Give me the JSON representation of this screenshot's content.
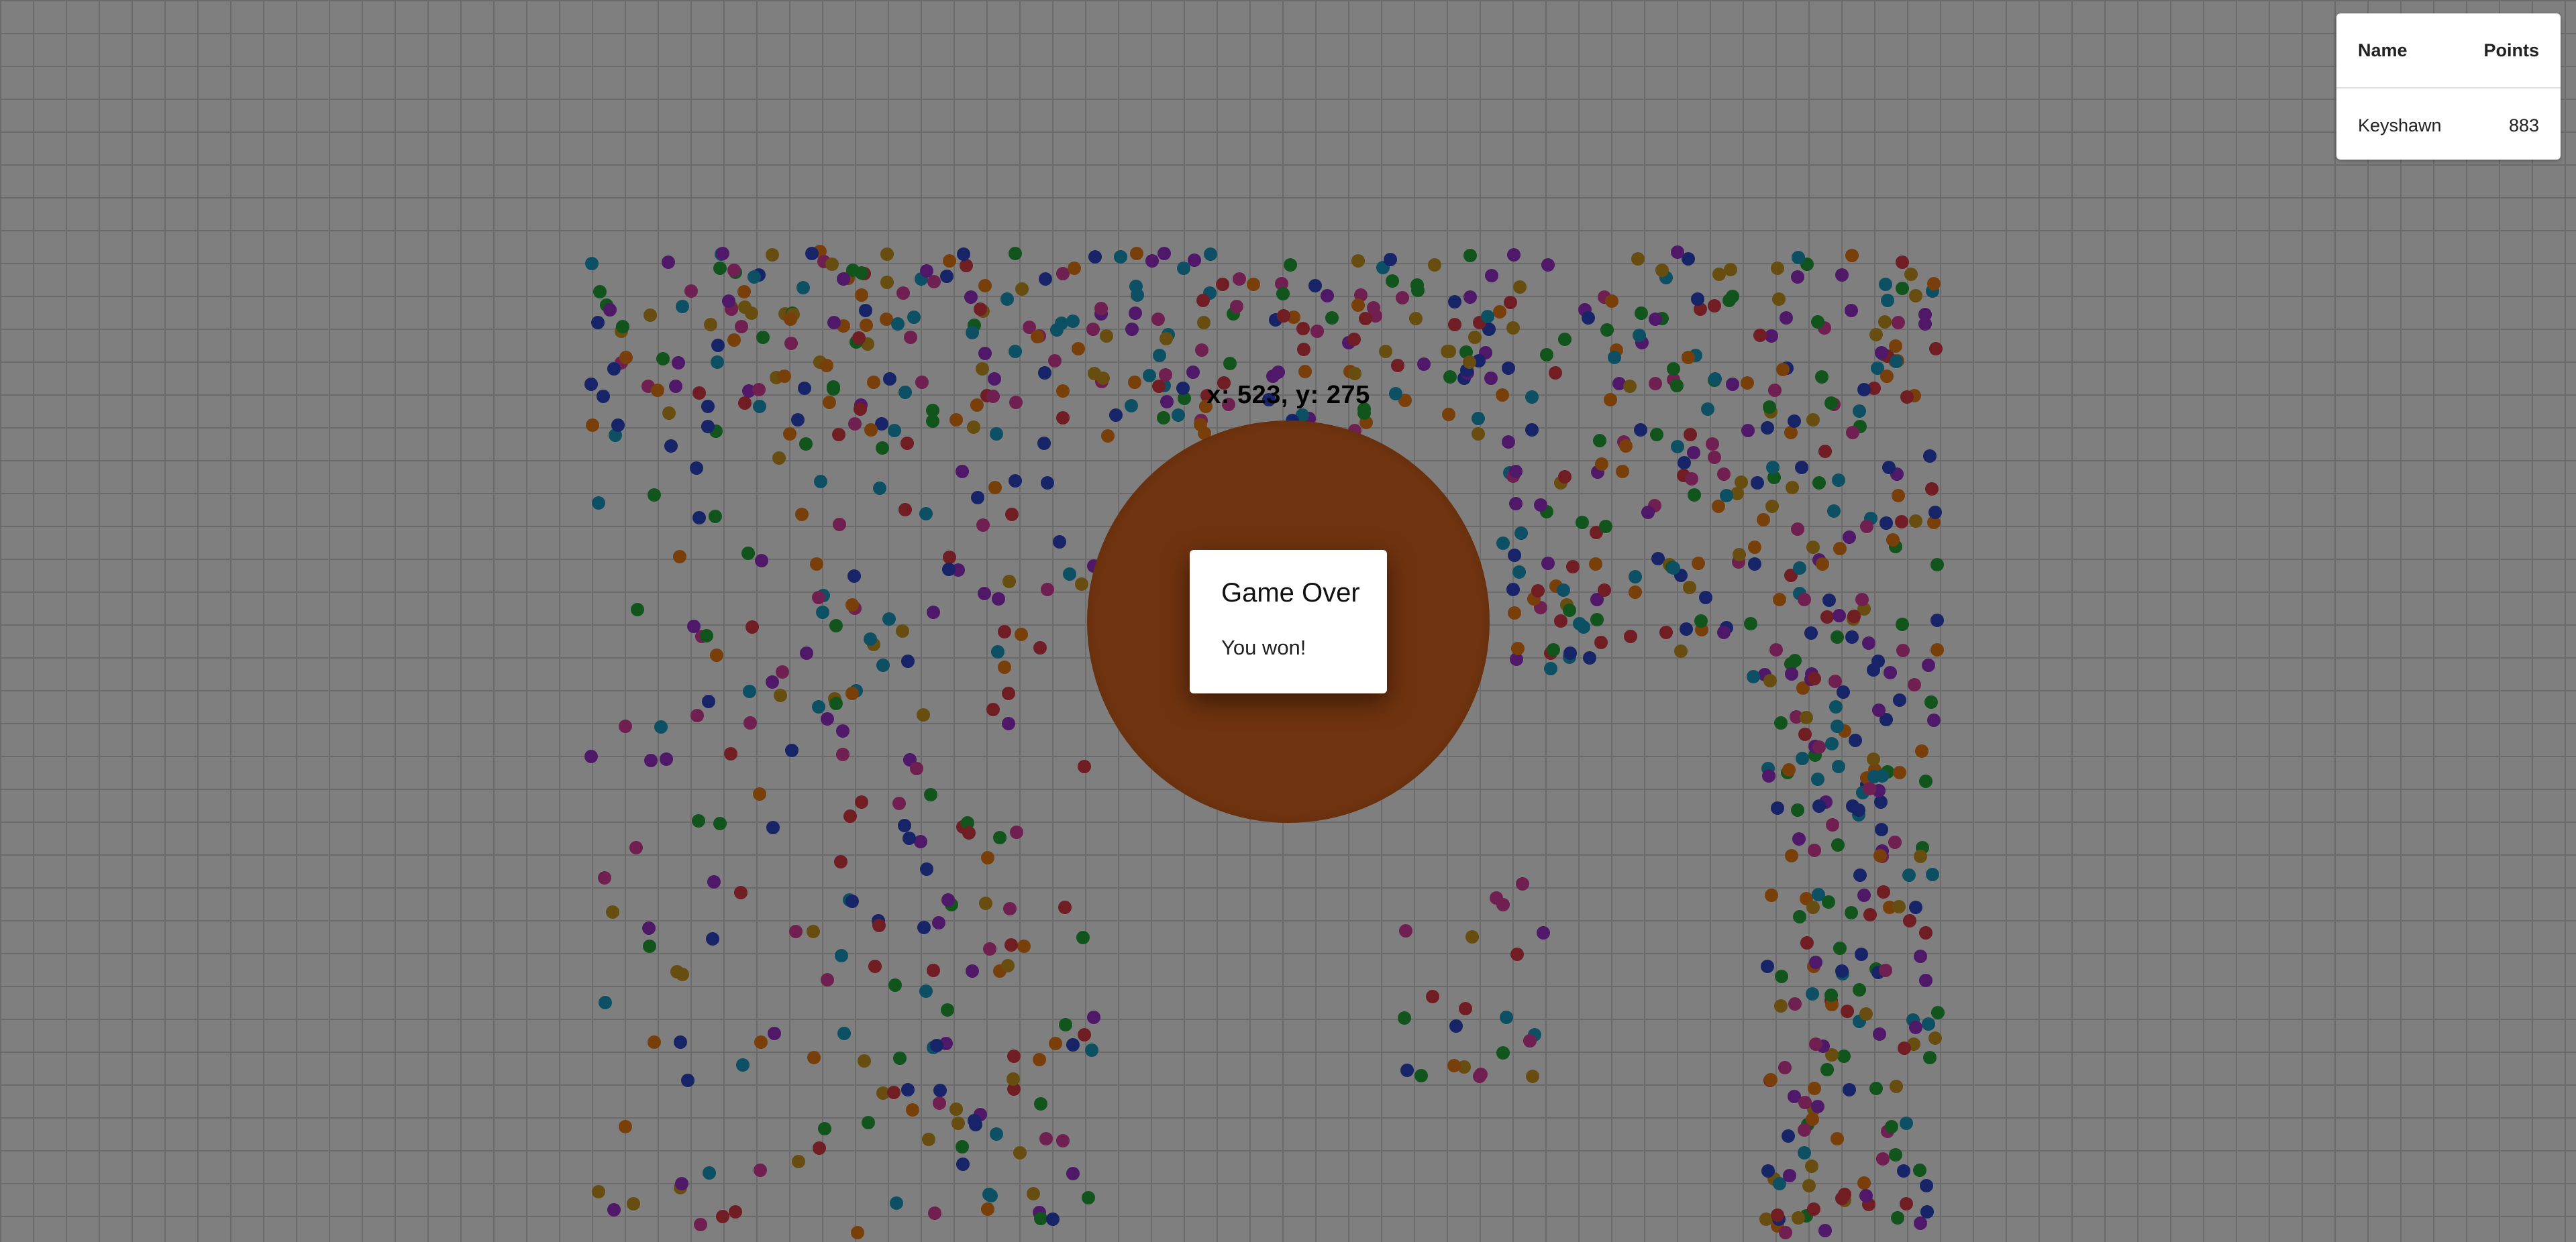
{
  "game": {
    "coordinates_label": "x: 523, y: 275",
    "player_color": "#e0671f",
    "food_colors": [
      "#e23a48",
      "#2f49d1",
      "#22a838",
      "#f07f16",
      "#a030d0",
      "#1aa0c8",
      "#e040a0",
      "#d09a20"
    ]
  },
  "leaderboard": {
    "header": {
      "name": "Name",
      "points": "Points"
    },
    "rows": [
      {
        "name": "Keyshawn",
        "points": "883"
      }
    ]
  },
  "dialog": {
    "title": "Game Over",
    "message": "You won!"
  }
}
